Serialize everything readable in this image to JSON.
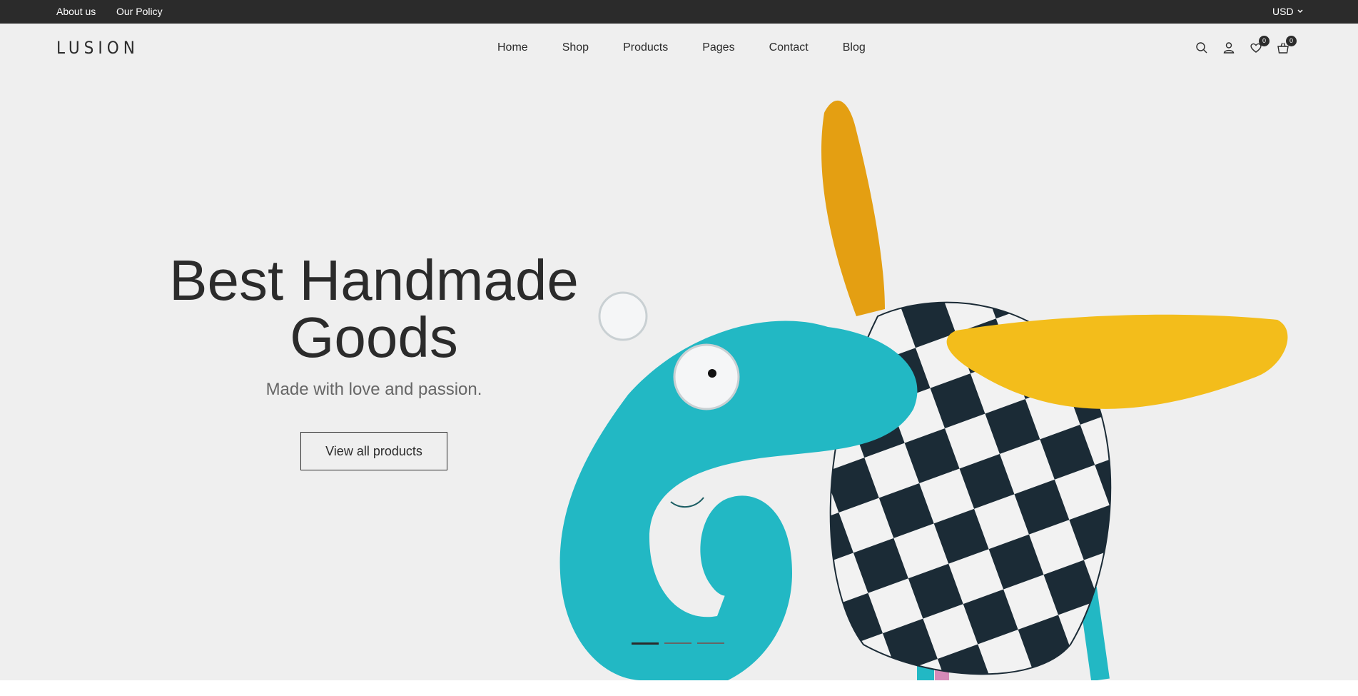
{
  "topbar": {
    "about": "About us",
    "policy": "Our Policy",
    "currency": "USD"
  },
  "header": {
    "logo": "LUSION",
    "nav": [
      "Home",
      "Shop",
      "Products",
      "Pages",
      "Contact",
      "Blog"
    ],
    "wishlist_count": "0",
    "cart_count": "0"
  },
  "hero": {
    "headline_1": "Best Handmade",
    "headline_2": "Goods",
    "subtitle": "Made with love and passion.",
    "cta": "View all products"
  },
  "colors": {
    "dark": "#2b2b2b",
    "hero_bg": "#efefef",
    "teal": "#22b8c4",
    "yellow": "#f2b51a"
  }
}
